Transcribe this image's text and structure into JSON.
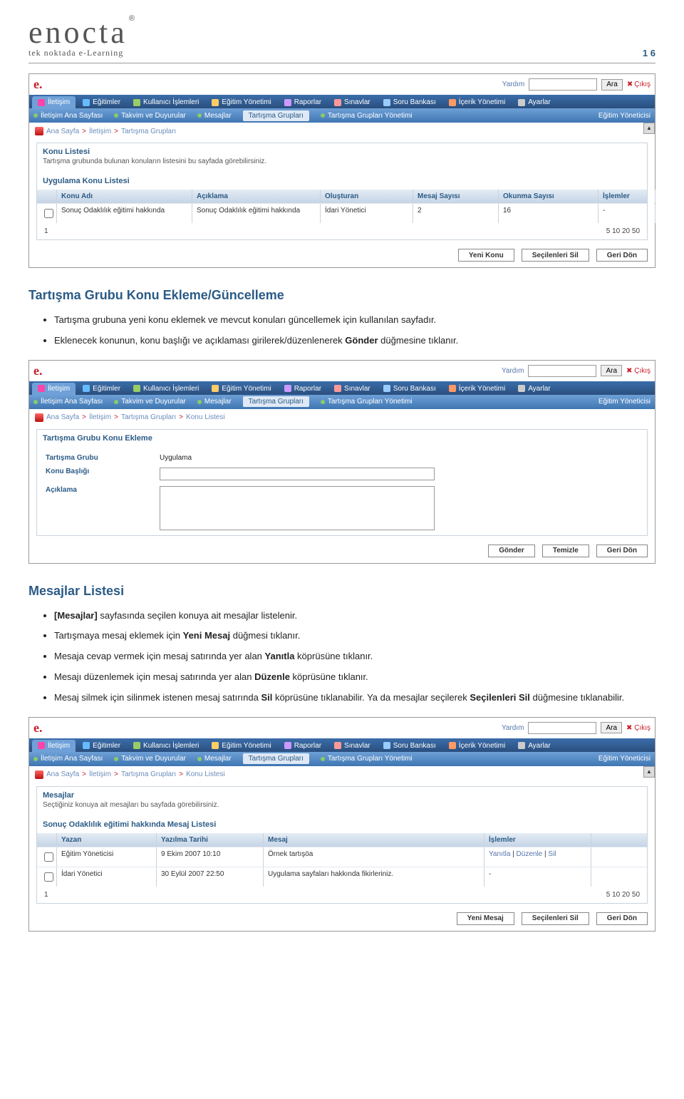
{
  "pageNumber": "1 6",
  "logo": {
    "name": "enocta",
    "tagline": "tek noktada e-Learning",
    "mark": "®"
  },
  "common": {
    "eLogo": "e.",
    "help": "Yardım",
    "searchBtn": "Ara",
    "exit": "Çıkış",
    "searchPh": "",
    "mainTabs": {
      "iletisim": "İletişim",
      "egitimler": "Eğitimler",
      "kullanici": "Kullanıcı İşlemleri",
      "egitimY": "Eğitim Yönetimi",
      "raporlar": "Raporlar",
      "sinavlar": "Sınavlar",
      "soru": "Soru Bankası",
      "icerik": "İçerik Yönetimi",
      "ayarlar": "Ayarlar"
    },
    "subTabs": {
      "ana": "İletişim Ana Sayfası",
      "takvim": "Takvim ve Duyurular",
      "mesajlar": "Mesajlar",
      "tg": "Tartışma Grupları",
      "tgy": "Tartışma Grupları Yönetimi"
    },
    "role": "Eğitim Yöneticisi"
  },
  "shot1": {
    "crumb": {
      "a": "Ana Sayfa",
      "b": "İletişim",
      "c": "Tartışma Grupları"
    },
    "panelTitle": "Konu Listesi",
    "panelSub": "Tartışma grubunda bulunan konuların listesini bu sayfada görebilirsiniz.",
    "listTitle": "Uygulama Konu Listesi",
    "headers": {
      "ad": "Konu Adı",
      "ack": "Açıklama",
      "ol": "Oluşturan",
      "ms": "Mesaj Sayısı",
      "ok": "Okunma Sayısı",
      "is": "İşlemler"
    },
    "row": {
      "ad": "Sonuç Odaklılık eğitimi hakkında",
      "ack": "Sonuç Odaklılık eğitimi hakkında",
      "ol": "İdari Yönetici",
      "ms": "2",
      "ok": "16",
      "is": "-"
    },
    "footerLeft": "1",
    "footerRight": "5 10 20 50",
    "btns": {
      "yeni": "Yeni Konu",
      "sil": "Seçilenleri Sil",
      "geri": "Geri Dön"
    }
  },
  "doc1": {
    "h": "Tartışma Grubu Konu Ekleme/Güncelleme",
    "li1a": "Tartışma grubuna yeni konu eklemek ve mevcut konuları güncellemek için kullanılan sayfadır.",
    "li1b_pre": "Eklenecek konunun, konu başlığı ve açıklaması girilerek/düzenlenerek ",
    "li1b_bold": "Gönder",
    "li1b_post": " düğmesine tıklanır."
  },
  "shot2": {
    "crumb": {
      "a": "Ana Sayfa",
      "b": "İletişim",
      "c": "Tartışma Grupları",
      "d": "Konu Listesi"
    },
    "panelTitle": "Tartışma Grubu Konu Ekleme",
    "f": {
      "grp": "Tartışma Grubu",
      "grpVal": "Uygulama",
      "baslik": "Konu Başlığı",
      "ack": "Açıklama"
    },
    "btns": {
      "gonder": "Gönder",
      "temizle": "Temizle",
      "geri": "Geri Dön"
    }
  },
  "doc2": {
    "h": "Mesajlar Listesi",
    "li1_pre": "",
    "li1_bold": "[Mesajlar]",
    "li1_post": " sayfasında seçilen konuya ait mesajlar listelenir.",
    "li2_pre": "Tartışmaya mesaj eklemek için ",
    "li2_bold": "Yeni Mesaj",
    "li2_post": " düğmesi tıklanır.",
    "li3_pre": "Mesaja cevap vermek için mesaj satırında yer alan ",
    "li3_bold": "Yanıtla",
    "li3_post": " köprüsüne tıklanır.",
    "li4_pre": "Mesajı düzenlemek için mesaj satırında yer alan ",
    "li4_bold": "Düzenle",
    "li4_post": " köprüsüne tıklanır.",
    "li5_pre": "Mesaj silmek için silinmek istenen mesaj satırında ",
    "li5_bold": "Sil",
    "li5_mid": " köprüsüne tıklanabilir. Ya da mesajlar seçilerek ",
    "li5_bold2": "Seçilenleri Sil",
    "li5_post": " düğmesine tıklanabilir."
  },
  "shot3": {
    "crumb": {
      "a": "Ana Sayfa",
      "b": "İletişim",
      "c": "Tartışma Grupları",
      "d": "Konu Listesi"
    },
    "panelTitle": "Mesajlar",
    "panelSub": "Seçtiğiniz konuya ait mesajları bu sayfada görebilirsiniz.",
    "listTitle": "Sonuç Odaklılık eğitimi hakkında Mesaj Listesi",
    "headers": {
      "yaz": "Yazan",
      "tarih": "Yazılma Tarihi",
      "msg": "Mesaj",
      "is": "İşlemler"
    },
    "row1": {
      "yaz": "Eğitim Yöneticisi",
      "tarih": "9 Ekim 2007 10:10",
      "msg": "Örnek tartışöa",
      "yan": "Yanıtla",
      "duz": "Düzenle",
      "sil": "Sil"
    },
    "row2": {
      "yaz": "İdari Yönetici",
      "tarih": "30 Eylül 2007 22:50",
      "msg": "Uygulama sayfaları hakkında fikirleriniz.",
      "is": "-"
    },
    "footerLeft": "1",
    "footerRight": "5 10 20 50",
    "btns": {
      "yeni": "Yeni Mesaj",
      "sil": "Seçilenleri Sil",
      "geri": "Geri Dön"
    }
  }
}
